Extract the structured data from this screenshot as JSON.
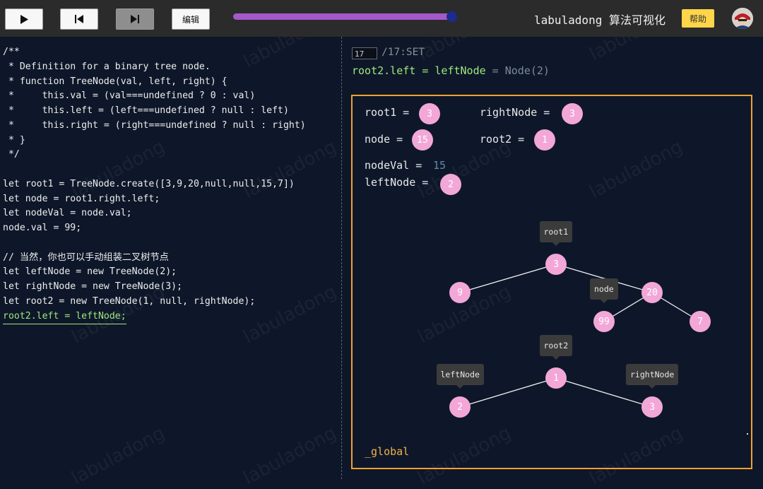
{
  "toolbar": {
    "edit_label": "编辑",
    "brand_title": "labuladong 算法可视化",
    "help_label": "帮助",
    "progress": 0.99
  },
  "code_lines": [
    "/**",
    " * Definition for a binary tree node.",
    " * function TreeNode(val, left, right) {",
    " *     this.val = (val===undefined ? 0 : val)",
    " *     this.left = (left===undefined ? null : left)",
    " *     this.right = (right===undefined ? null : right)",
    " * }",
    " */",
    "",
    "let root1 = TreeNode.create([3,9,20,null,null,15,7])",
    "let node = root1.right.left;",
    "let nodeVal = node.val;",
    "node.val = 99;",
    "",
    "// 当然，你也可以手动组装二叉树节点",
    "let leftNode = new TreeNode(2);",
    "let rightNode = new TreeNode(3);",
    "let root2 = new TreeNode(1, null, rightNode);",
    "root2.left = leftNode;"
  ],
  "highlight_line_index": 18,
  "step": {
    "current": "17",
    "total_text": "/17:SET"
  },
  "statement": {
    "code": "root2.left = leftNode",
    "eq": " = ",
    "value": "Node(2)"
  },
  "variables": {
    "root1_label": "root1 = ",
    "root1_value": "3",
    "rightNode_label": "rightNode = ",
    "rightNode_value": "3",
    "node_label": "node = ",
    "node_value": "15",
    "root2_label": "root2 = ",
    "root2_value": "1",
    "nodeVal_label": "nodeVal = ",
    "nodeVal_value": "15",
    "leftNode_label": "leftNode = ",
    "leftNode_value": "2"
  },
  "tree_nodes": {
    "r1_root": "3",
    "r1_left": "9",
    "r1_right": "20",
    "r1_rl": "99",
    "r1_rr": "7",
    "r2_root": "1",
    "r2_left": "2",
    "r2_right": "3"
  },
  "tags": {
    "root1": "root1",
    "node": "node",
    "root2": "root2",
    "leftNode": "leftNode",
    "rightNode": "rightNode"
  },
  "global_label": "_global",
  "watermark": "labuladong",
  "colors": {
    "node_fill": "#f2a7d8",
    "frame_border": "#f0a030",
    "highlight_code": "#9fe87f",
    "help_button": "#ffd54a",
    "progress_fill": "#a35ac8"
  }
}
